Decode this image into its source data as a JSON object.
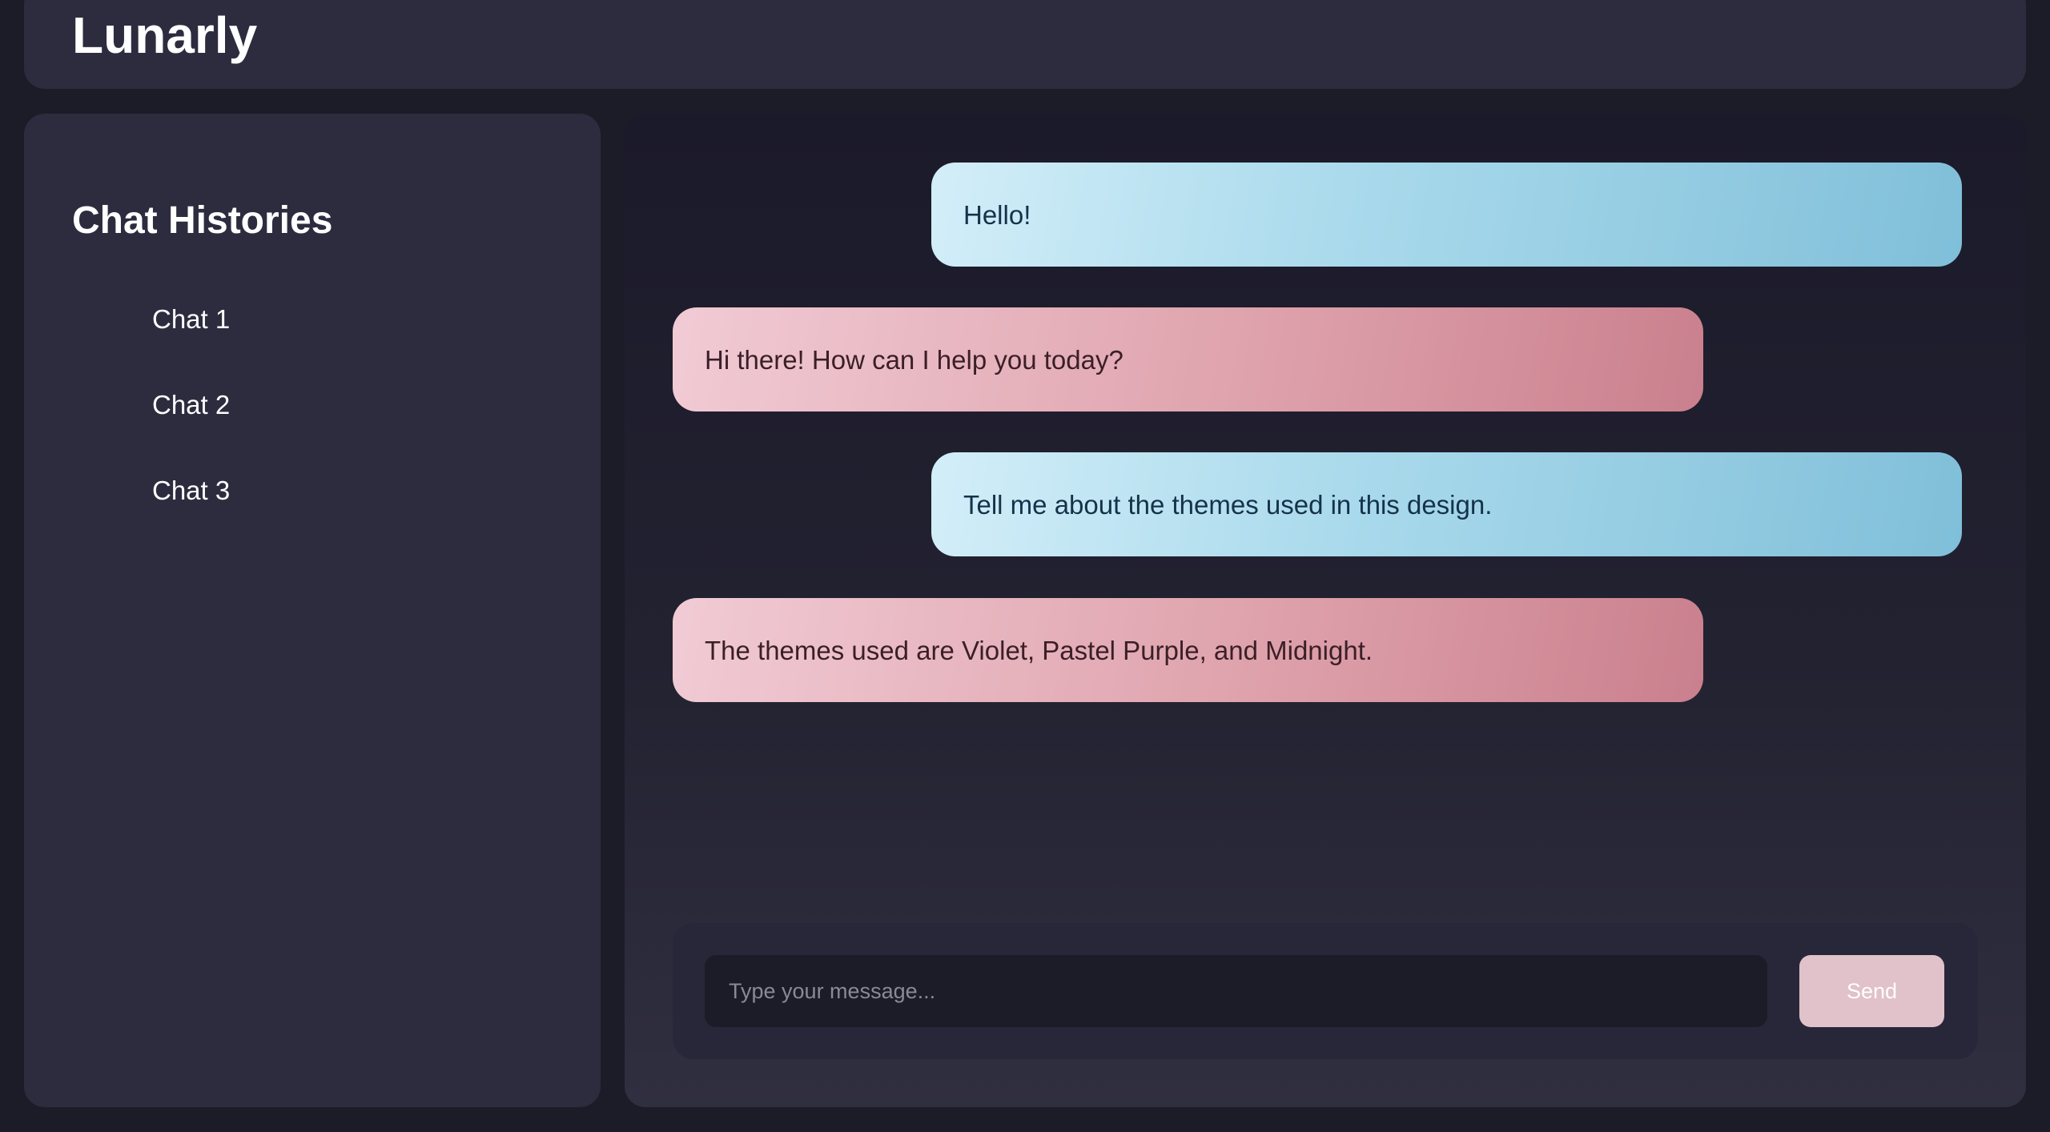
{
  "header": {
    "title": "Lunarly"
  },
  "sidebar": {
    "title": "Chat Histories",
    "items": [
      {
        "label": "Chat 1"
      },
      {
        "label": "Chat 2"
      },
      {
        "label": "Chat 3"
      }
    ]
  },
  "messages": [
    {
      "role": "user",
      "text": "Hello!"
    },
    {
      "role": "bot",
      "text": "Hi there! How can I help you today?"
    },
    {
      "role": "user",
      "text": "Tell me about the themes used in this design."
    },
    {
      "role": "bot",
      "text": "The themes used are Violet, Pastel Purple, and Midnight."
    }
  ],
  "composer": {
    "placeholder": "Type your message...",
    "send_label": "Send"
  },
  "colors": {
    "background": "#1c1c28",
    "panel": "#2d2c3f",
    "user_bubble": "#aadaec",
    "bot_bubble": "#dfa3ad",
    "send_button": "#e1c1ca"
  }
}
